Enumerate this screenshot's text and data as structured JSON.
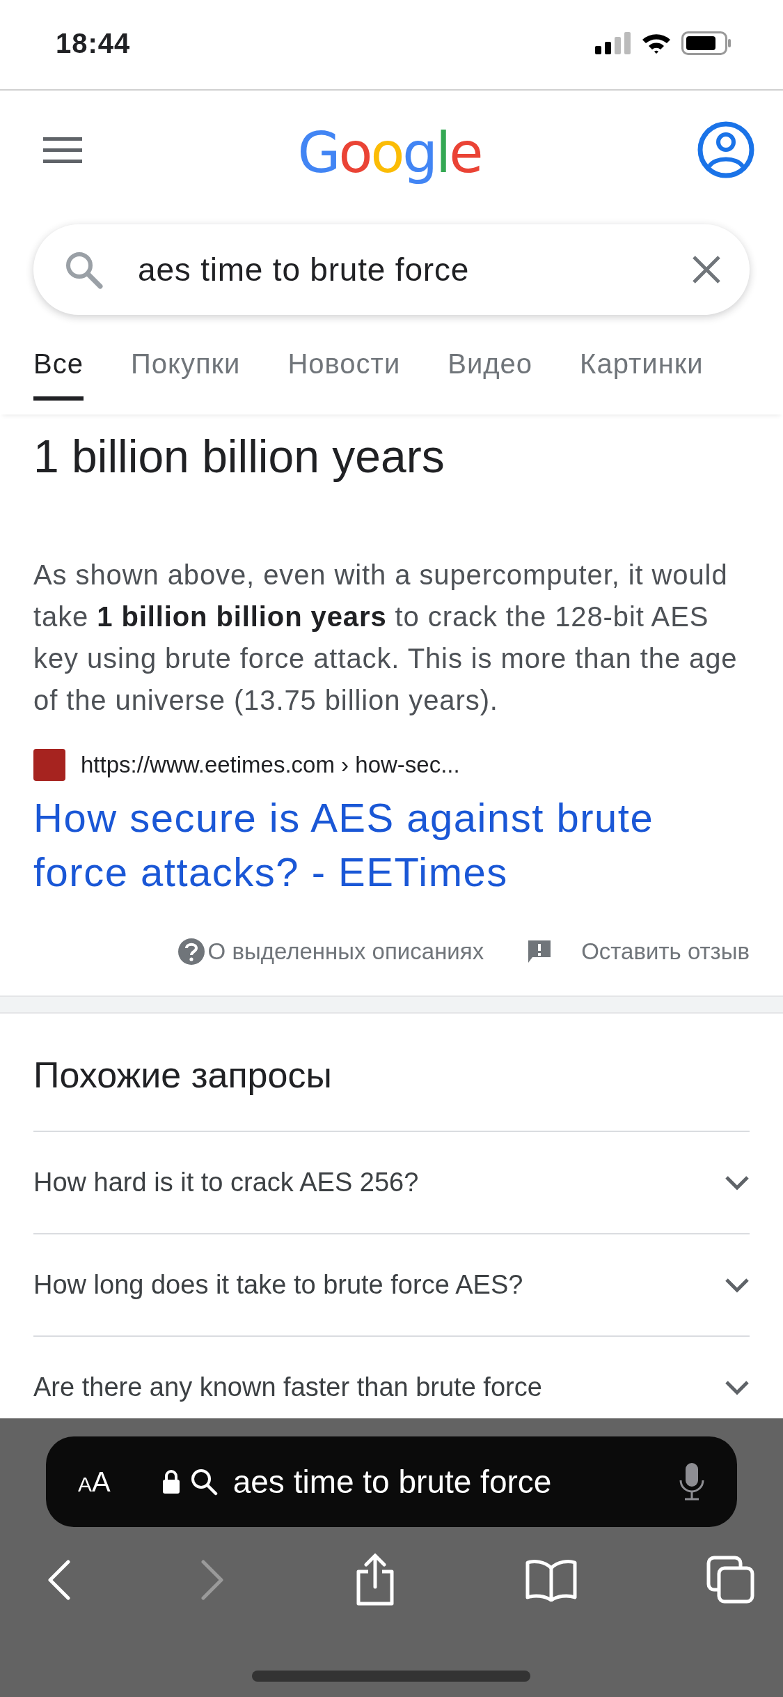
{
  "status_bar": {
    "time": "18:44"
  },
  "header": {
    "logo": "Google"
  },
  "search": {
    "value": "aes time to brute force"
  },
  "tabs": [
    {
      "label": "Все",
      "selected": true
    },
    {
      "label": "Покупки",
      "selected": false
    },
    {
      "label": "Новости",
      "selected": false
    },
    {
      "label": "Видео",
      "selected": false
    },
    {
      "label": "Картинки",
      "selected": false
    }
  ],
  "featured_snippet": {
    "answer": "1 billion billion years",
    "text": "As shown above, even with a supercomputer, it would take **1 billion billion years** to crack the 128-bit AES key using brute force attack. This is more than the age of the universe (13.75 billion years).",
    "source_url": "https://www.eetimes.com › how-sec...",
    "title": "How secure is AES against brute force attacks? - EETimes",
    "about_link": "О выделенных описаниях",
    "feedback_link": "Оставить отзыв"
  },
  "related": {
    "heading": "Похожие запросы",
    "items": [
      {
        "text": "How hard is it to crack AES 256?"
      },
      {
        "text": "How long does it take to brute force AES?"
      },
      {
        "text": "Are there any known faster than brute force"
      }
    ]
  },
  "browser_toolbar": {
    "text_size_button": "AA",
    "address": "aes time to brute force"
  }
}
